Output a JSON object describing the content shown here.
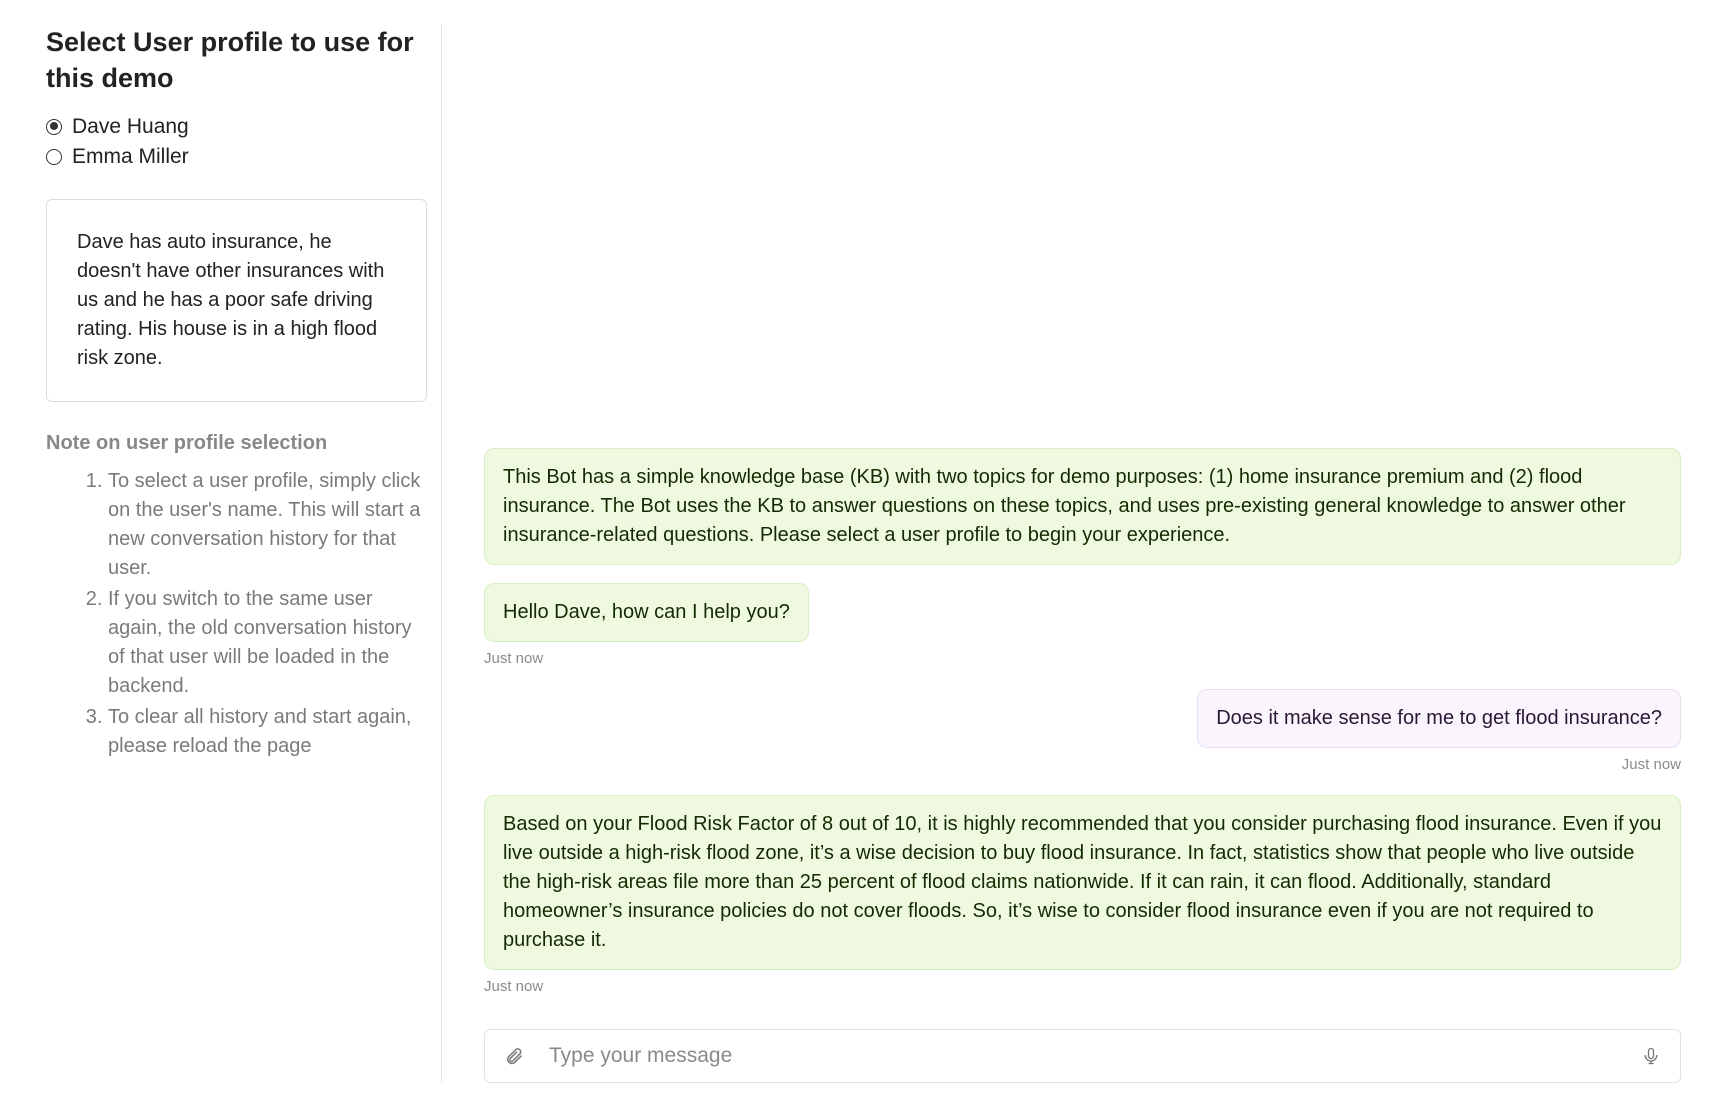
{
  "sidebar": {
    "heading": "Select User profile to use for this demo",
    "profiles": [
      {
        "name": "Dave Huang",
        "checked": true
      },
      {
        "name": "Emma Miller",
        "checked": false
      }
    ],
    "profile_description": "Dave has auto insurance, he doesn't have other insurances with us and he has a poor safe driving rating. His house is in a high flood risk zone.",
    "notes_heading": "Note on user profile selection",
    "notes": [
      "To select a user profile, simply click on the user's name. This will start a new conversation history for that user.",
      "If you switch to the same user again, the old conversation history of that user will be loaded in the backend.",
      "To clear all history and start again, please reload the page"
    ]
  },
  "chat": {
    "messages": [
      {
        "role": "bot",
        "wide": true,
        "text": "This Bot has a simple knowledge base (KB) with two topics for demo purposes: (1) home insurance premium and (2) flood insurance. The Bot uses the KB to answer questions on these topics, and uses pre-existing general knowledge to answer other insurance-related questions. Please select a user profile to begin your experience."
      },
      {
        "role": "bot",
        "wide": false,
        "text": "Hello Dave, how can I help you?",
        "timestamp": "Just now"
      },
      {
        "role": "user",
        "wide": false,
        "text": "Does it make sense for me to get flood insurance?",
        "timestamp": "Just now"
      },
      {
        "role": "bot",
        "wide": true,
        "text": "Based on your Flood Risk Factor of 8 out of 10, it is highly recommended that you consider purchasing flood insurance. Even if you live outside a high-risk flood zone, it’s a wise decision to buy flood insurance. In fact, statistics show that people who live outside the high-risk areas file more than 25 percent of flood claims nationwide. If it can rain, it can flood. Additionally, standard homeowner’s insurance policies do not cover floods. So, it’s wise to consider flood insurance even if you are not required to purchase it.",
        "timestamp": "Just now"
      }
    ],
    "input_placeholder": "Type your message"
  }
}
